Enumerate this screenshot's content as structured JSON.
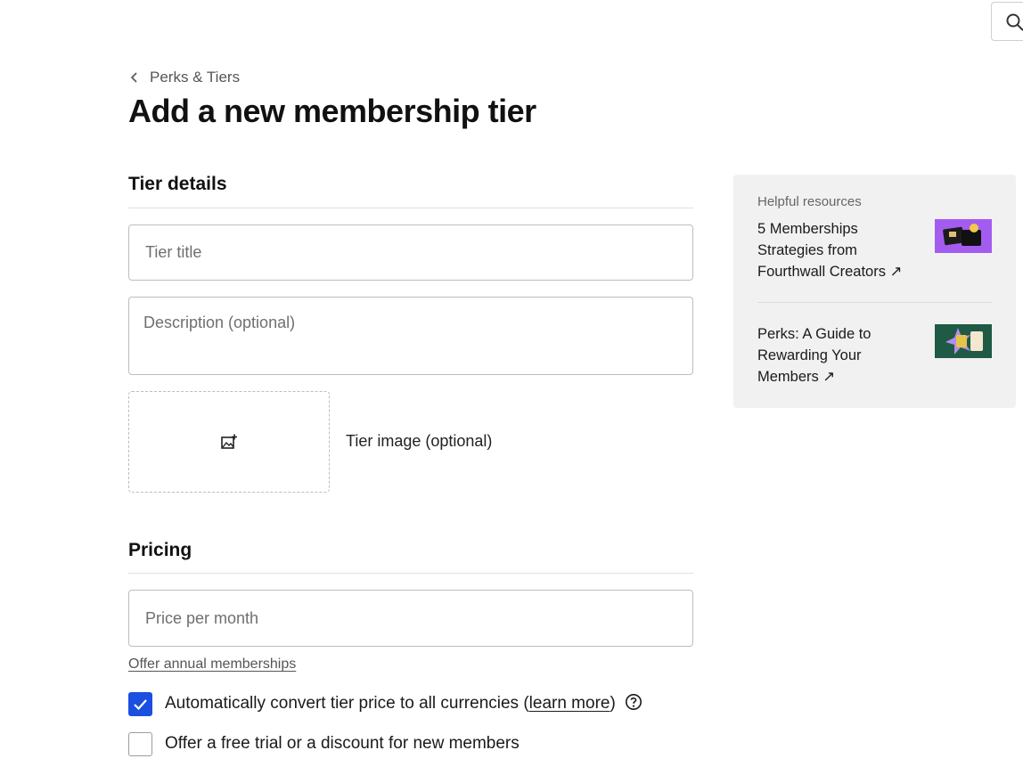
{
  "header": {
    "search_icon": "search-icon"
  },
  "breadcrumb": {
    "label": "Perks & Tiers",
    "icon": "chevron-left-icon"
  },
  "page_title": "Add a new membership tier",
  "tier_details": {
    "heading": "Tier details",
    "title_placeholder": "Tier title",
    "title_value": "",
    "description_placeholder": "Description (optional)",
    "description_value": "",
    "image_label": "Tier image (optional)",
    "image_icon": "add-image-icon"
  },
  "pricing": {
    "heading": "Pricing",
    "price_placeholder": "Price per month",
    "price_value": "",
    "annual_link": "Offer annual memberships",
    "convert_checked": true,
    "convert_label_before": "Automatically convert tier price to all currencies (",
    "convert_link": "learn more",
    "convert_label_after": ")",
    "help_icon": "question-circle-icon",
    "trial_checked": false,
    "trial_label": "Offer a free trial or a discount for new members"
  },
  "resources": {
    "heading": "Helpful resources",
    "items": [
      {
        "title": "5 Memberships Strategies from Fourthwall Creators",
        "arrow": "↗",
        "thumb_color": "#a45cf0"
      },
      {
        "title": "Perks: A Guide to Rewarding Your Members",
        "arrow": "↗",
        "thumb_color": "#1f5a44"
      }
    ]
  },
  "colors": {
    "accent": "#1a4fe0",
    "panel_bg": "#f1f1f1",
    "border": "#bdbdbd"
  }
}
